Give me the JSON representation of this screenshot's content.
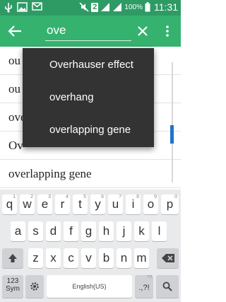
{
  "status_bar": {
    "sim_badge": "2",
    "battery": "100%",
    "time": "11:31",
    "icons": [
      "usb-icon",
      "image-icon",
      "mail-icon",
      "mute-icon",
      "signal-icon",
      "signal-icon",
      "battery-icon"
    ]
  },
  "toolbar": {
    "query": "ove",
    "icons": [
      "back-arrow-icon",
      "clear-icon",
      "more-vert-icon"
    ],
    "color": "#36b26f"
  },
  "list": {
    "rows": [
      "ou",
      "ou",
      "ove",
      "Ov",
      "overlapping gene"
    ]
  },
  "suggestions": [
    "Overhauser effect",
    "overhang",
    "overlapping gene"
  ],
  "keyboard": {
    "row1": [
      {
        "key": "q",
        "hint": "1"
      },
      {
        "key": "w",
        "hint": "2"
      },
      {
        "key": "e",
        "hint": "3"
      },
      {
        "key": "r",
        "hint": "4"
      },
      {
        "key": "t",
        "hint": "5"
      },
      {
        "key": "y",
        "hint": "6"
      },
      {
        "key": "u",
        "hint": "7"
      },
      {
        "key": "i",
        "hint": "8"
      },
      {
        "key": "o",
        "hint": "9"
      },
      {
        "key": "p",
        "hint": "0"
      }
    ],
    "row2": [
      "a",
      "s",
      "d",
      "f",
      "g",
      "h",
      "j",
      "k",
      "l"
    ],
    "row3": [
      "z",
      "x",
      "c",
      "v",
      "b",
      "n",
      "m"
    ],
    "sym_label": "123\nSym",
    "space_label": "English(US)",
    "punct_label": ".,?!",
    "punct_hint": "*?"
  }
}
